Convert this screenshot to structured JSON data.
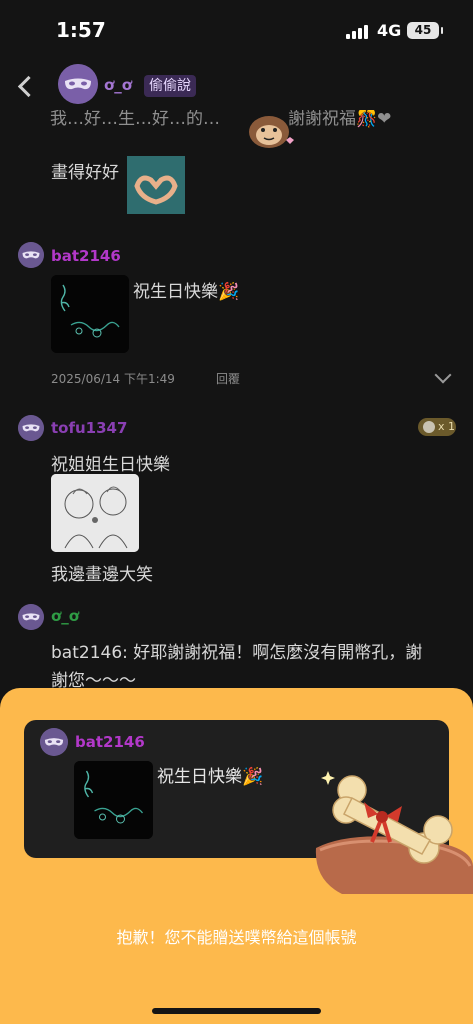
{
  "status_bar": {
    "time": "1:57",
    "network": "4G",
    "battery": "45"
  },
  "header": {
    "name": "ơ_ơ",
    "tag": "偷偷說"
  },
  "feed": {
    "partial_top": "我…好…生…好…的…　　　　謝謝祝福🎊❤",
    "messages": [
      {
        "text": "畫得好好"
      },
      {
        "username": "bat2146",
        "text": "祝生日快樂🎉",
        "timestamp": "2025/06/14 下午1:49",
        "reply_label": "回覆"
      },
      {
        "username": "tofu1347",
        "text": "祝姐姐生日快樂",
        "caption": "我邊畫邊大笑",
        "gift_count": "x 1"
      },
      {
        "username": "ơ_ơ",
        "text_line1": "bat2146: 好耶謝謝祝福！啊怎麼沒有開幣孔，謝",
        "text_line2": "謝您～～～"
      }
    ]
  },
  "sheet": {
    "preview": {
      "username": "bat2146",
      "text": "祝生日快樂🎉"
    },
    "message": "抱歉！您不能贈送噗幣給這個帳號"
  },
  "colors": {
    "background": "#141414",
    "sheet": "#fdb94c",
    "bat_name": "#b238c9",
    "tofu_name": "#8a3fb3",
    "self_name": "#2f9c45"
  }
}
